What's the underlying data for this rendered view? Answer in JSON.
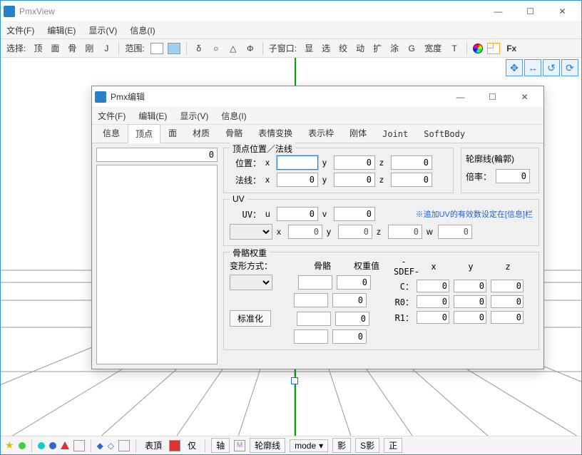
{
  "main": {
    "title": "PmxView",
    "menus": [
      "文件(F)",
      "编辑(E)",
      "显示(V)",
      "信息(I)"
    ],
    "toolbar": {
      "select_label": "选择:",
      "sel_items": [
        "顶",
        "面",
        "骨",
        "刚",
        "J"
      ],
      "range_label": "范围:",
      "sym_items": [
        "δ",
        "○",
        "△",
        "Φ"
      ],
      "subwin_label": "子窗口:",
      "subwin_items": [
        "显",
        "选",
        "绞",
        "动",
        "扩",
        "涂",
        "G",
        "宽度",
        "T"
      ],
      "fx": "Fx"
    }
  },
  "dialog": {
    "title": "Pmx编辑",
    "menus": [
      "文件(F)",
      "编辑(E)",
      "显示(V)",
      "信息(I)"
    ],
    "tabs": [
      "信息",
      "顶点",
      "面",
      "材质",
      "骨骼",
      "表情变换",
      "表示枠",
      "刚体",
      "Joint",
      "SoftBody"
    ],
    "active_tab": 1,
    "list_count": "0",
    "g_pos": {
      "title": "顶点位置／法线",
      "pos_label": "位置：",
      "norm_label": "法线：",
      "x": "x",
      "y": "y",
      "z": "z",
      "pos": {
        "x": "",
        "y": "0",
        "z": "0"
      },
      "norm": {
        "x": "0",
        "y": "0",
        "z": "0"
      },
      "outline_title": "轮廓线(輪郭)",
      "rate_label": "倍率：",
      "rate": "0"
    },
    "g_uv": {
      "title": "UV",
      "uv_label": "UV：",
      "u": "u",
      "v": "v",
      "uv": {
        "u": "0",
        "v": "0"
      },
      "note": "※追加UV的有效数设定在[信息]栏",
      "extra": {
        "x": "0",
        "y": "0",
        "z": "0",
        "w": "0"
      }
    },
    "g_weight": {
      "title": "骨骼权重",
      "deform_label": "变形方式：",
      "col_bone": "骨骼",
      "col_weight": "权重值",
      "normalize": "标准化",
      "rows": [
        {
          "bone": "",
          "w": "0"
        },
        {
          "bone": "",
          "w": "0"
        },
        {
          "bone": "",
          "w": "0"
        },
        {
          "bone": "",
          "w": "0"
        }
      ],
      "sdef_title": "-SDEF-",
      "sdef_cols": [
        "x",
        "y",
        "z"
      ],
      "sdef_rows": {
        "C": [
          "0",
          "0",
          "0"
        ],
        "R0": [
          "0",
          "0",
          "0"
        ],
        "R1": [
          "0",
          "0",
          "0"
        ]
      }
    }
  },
  "status": {
    "items": [
      "表頂",
      "仅"
    ],
    "axis": "轴",
    "outline": "轮廓线",
    "mode": "mode",
    "shadow": "影",
    "sshadow": "S影",
    "normal": "正"
  }
}
